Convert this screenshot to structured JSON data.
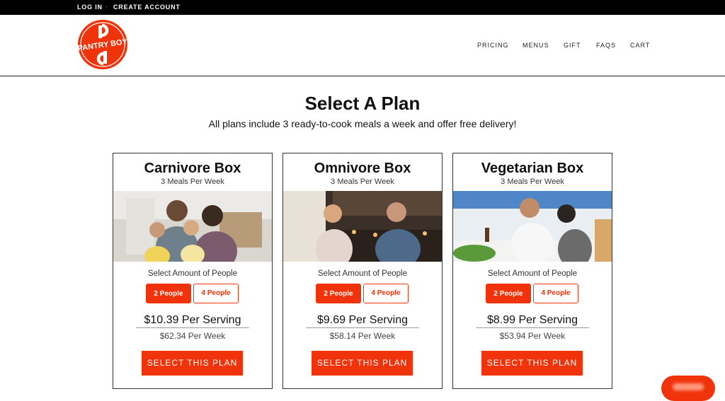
{
  "topbar": {
    "login": "LOG IN",
    "separator": "·",
    "create_account": "CREATE ACCOUNT"
  },
  "logo": {
    "text": "PANTRY BOY",
    "icon": "pantry-boy-logo",
    "color": "#f0330a"
  },
  "nav": {
    "pricing": "PRICING",
    "menus": "MENUS",
    "gift": "GIFT",
    "faqs": "FAQS",
    "cart": "CART"
  },
  "page": {
    "title": "Select A Plan",
    "subtitle": "All plans include 3 ready-to-cook meals a week and offer free delivery!"
  },
  "plans": [
    {
      "title": "Carnivore Box",
      "meals": "3 Meals Per Week",
      "image": "family-kitchen-photo",
      "people_label": "Select Amount of People",
      "option_2": "2 People",
      "option_4": "4 People",
      "price_serving": "$10.39 Per Serving",
      "price_week": "$62.34 Per Week",
      "cta": "SELECT THIS PLAN"
    },
    {
      "title": "Omnivore Box",
      "meals": "3 Meals Per Week",
      "image": "couple-kitchen-photo",
      "people_label": "Select Amount of People",
      "option_2": "2 People",
      "option_4": "4 People",
      "price_serving": "$9.69 Per Serving",
      "price_week": "$58.14 Per Week",
      "cta": "SELECT THIS PLAN"
    },
    {
      "title": "Vegetarian Box",
      "meals": "3 Meals Per Week",
      "image": "couple-cooking-photo",
      "people_label": "Select Amount of People",
      "option_2": "2 People",
      "option_4": "4 People",
      "price_serving": "$8.99 Per Serving",
      "price_week": "$53.94 Per Week",
      "cta": "SELECT THIS PLAN"
    }
  ],
  "colors": {
    "accent": "#f0330a",
    "topbar": "#000000"
  },
  "chat": {
    "icon": "chat-widget-icon"
  }
}
